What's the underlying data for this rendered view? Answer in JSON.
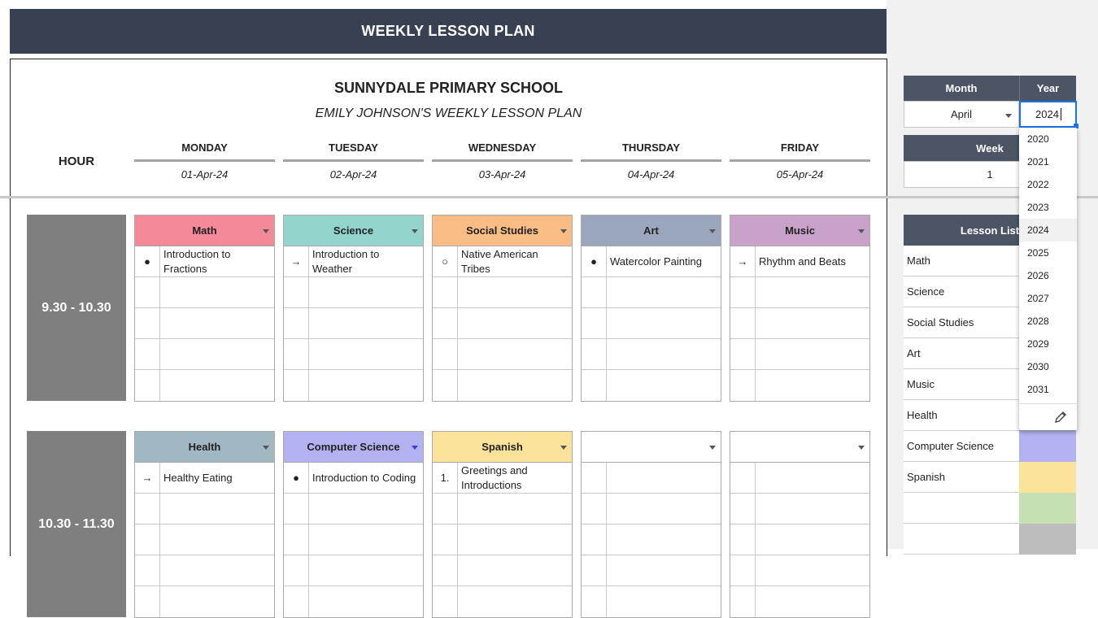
{
  "header": {
    "title": "WEEKLY LESSON PLAN"
  },
  "school": {
    "name": "SUNNYDALE PRIMARY SCHOOL",
    "subtitle": "EMILY JOHNSON'S WEEKLY LESSON PLAN"
  },
  "hour_label": "HOUR",
  "days": [
    {
      "name": "MONDAY",
      "date": "01-Apr-24"
    },
    {
      "name": "TUESDAY",
      "date": "02-Apr-24"
    },
    {
      "name": "WEDNESDAY",
      "date": "03-Apr-24"
    },
    {
      "name": "THURSDAY",
      "date": "04-Apr-24"
    },
    {
      "name": "FRIDAY",
      "date": "05-Apr-24"
    }
  ],
  "slots": [
    {
      "time": "9.30 - 10.30",
      "lessons": [
        {
          "subject": "Math",
          "color": "#f4899a",
          "mark": "●",
          "topic": "Introduction to Fractions"
        },
        {
          "subject": "Science",
          "color": "#93d5cd",
          "mark": "→",
          "topic": "Introduction to Weather"
        },
        {
          "subject": "Social Studies",
          "color": "#f9bc85",
          "mark": "○",
          "topic": "Native American Tribes"
        },
        {
          "subject": "Art",
          "color": "#9aa6bd",
          "mark": "●",
          "topic": "Watercolor Painting"
        },
        {
          "subject": "Music",
          "color": "#c9a2c9",
          "mark": "→",
          "topic": "Rhythm and Beats"
        }
      ]
    },
    {
      "time": "10.30 - 11.30",
      "lessons": [
        {
          "subject": "Health",
          "color": "#9fb8c1",
          "mark": "→",
          "topic": "Healthy Eating"
        },
        {
          "subject": "Computer Science",
          "color": "#b3b1ef",
          "mark": "●",
          "topic": "Introduction to Coding"
        },
        {
          "subject": "Spanish",
          "color": "#fbe299",
          "mark": "1.",
          "topic": "Greetings and Introductions"
        },
        {
          "subject": "",
          "color": "#ffffff",
          "mark": "",
          "topic": ""
        },
        {
          "subject": "",
          "color": "#ffffff",
          "mark": "",
          "topic": ""
        }
      ]
    }
  ],
  "controls": {
    "month_label": "Month",
    "year_label": "Year",
    "month_value": "April",
    "year_value": "2024",
    "week_label": "Week",
    "week_value": "1"
  },
  "year_options": [
    "2020",
    "2021",
    "2022",
    "2023",
    "2024",
    "2025",
    "2026",
    "2027",
    "2028",
    "2029",
    "2030",
    "2031"
  ],
  "year_selected": "2024",
  "lesson_list": {
    "header": "Lesson List",
    "items": [
      {
        "name": "Math",
        "color": "#f4899a"
      },
      {
        "name": "Science",
        "color": "#93d5cd"
      },
      {
        "name": "Social Studies",
        "color": "#f9bc85"
      },
      {
        "name": "Art",
        "color": "#9aa6bd"
      },
      {
        "name": "Music",
        "color": "#c9a2c9"
      },
      {
        "name": "Health",
        "color": "#9fb8c1"
      },
      {
        "name": "Computer Science",
        "color": "#b3b1ef"
      },
      {
        "name": "Spanish",
        "color": "#fbe299"
      },
      {
        "name": "",
        "color": "#c6e0b4"
      },
      {
        "name": "",
        "color": "#bdbdbd"
      }
    ]
  }
}
